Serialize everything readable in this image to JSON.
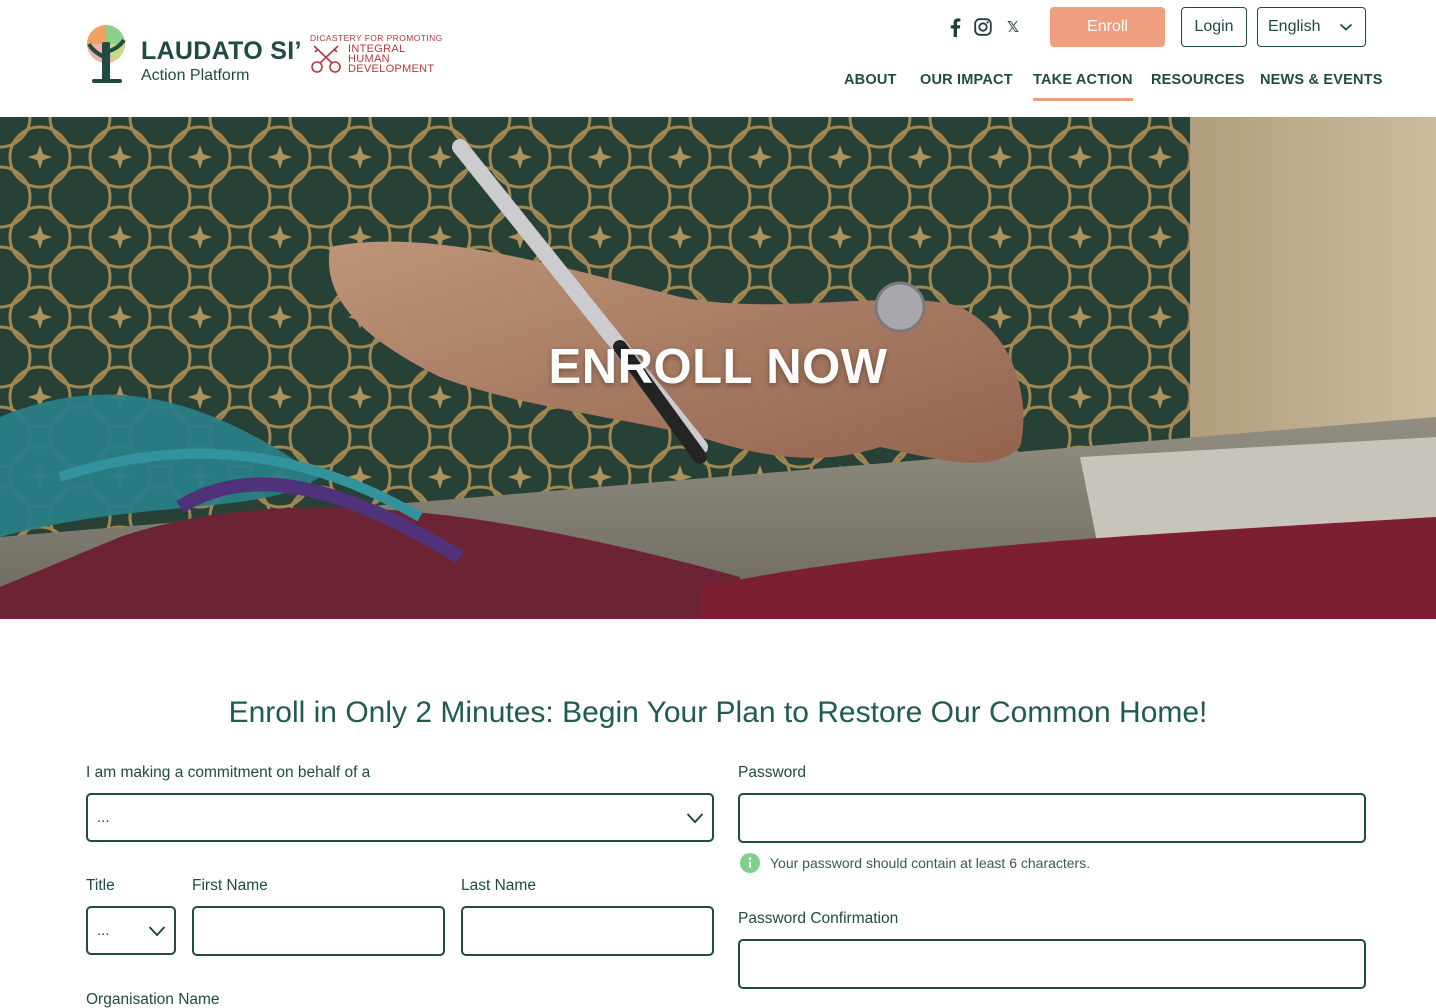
{
  "header": {
    "logo_title": "LAUDATO SI’",
    "logo_subtitle": "Action Platform",
    "partner": {
      "line_top": "DICASTERY FOR PROMOTING",
      "line1": "INTEGRAL",
      "line2": "HUMAN",
      "line3": "DEVELOPMENT"
    },
    "social_icons": [
      "facebook-icon",
      "instagram-icon",
      "x-icon"
    ],
    "x_glyph": "𝕏",
    "enroll_label": "Enroll",
    "login_label": "Login",
    "language": "English",
    "nav": [
      "ABOUT",
      "OUR IMPACT",
      "TAKE ACTION",
      "RESOURCES",
      "NEWS & EVENTS"
    ],
    "active_nav": "TAKE ACTION"
  },
  "hero": {
    "title": "ENROLL NOW"
  },
  "form": {
    "heading": "Enroll in Only 2 Minutes: Begin Your Plan to Restore Our Common Home!",
    "behalf_label": "I am making a commitment on behalf of a",
    "behalf_value": "...",
    "title_label": "Title",
    "title_value": "...",
    "first_name_label": "First Name",
    "first_name_value": "",
    "last_name_label": "Last Name",
    "last_name_value": "",
    "organisation_label": "Organisation Name",
    "password_label": "Password",
    "password_value": "",
    "password_hint": "Your password should contain at least 6 characters.",
    "password_confirmation_label": "Password Confirmation",
    "password_confirmation_value": ""
  },
  "colors": {
    "brand_green": "#1f4b43",
    "accent_orange": "#ef9f7f",
    "partner_red": "#b23b40",
    "hint_green": "#7fcf8f"
  }
}
